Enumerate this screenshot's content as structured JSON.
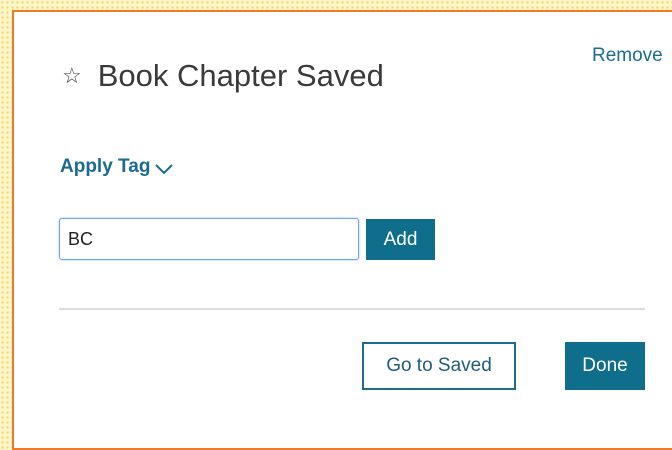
{
  "dialog": {
    "remove_label": "Remove",
    "title": "Book Chapter Saved",
    "star_icon": "star-outline-icon"
  },
  "tagging": {
    "apply_tag_label": "Apply Tag",
    "dropdown_icon": "chevron-down-icon",
    "input_value": "BC",
    "add_label": "Add"
  },
  "footer": {
    "go_to_saved_label": "Go to Saved",
    "done_label": "Done"
  },
  "colors": {
    "accent": "#0f6e8c",
    "link": "#1a6d8e",
    "dialog_border": "#f07a26",
    "backdrop": "#fdf6c8"
  }
}
